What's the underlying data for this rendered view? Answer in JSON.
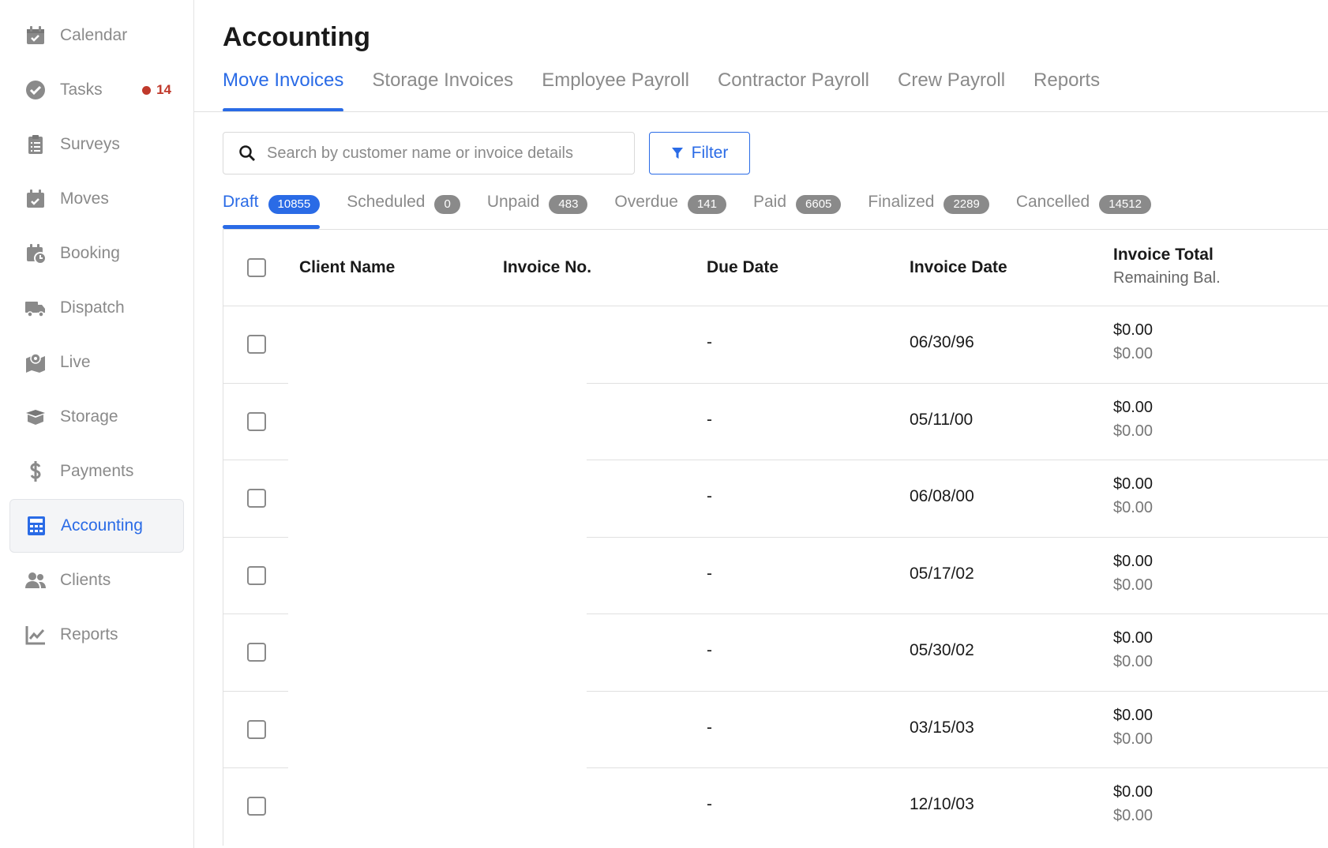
{
  "sidebar": {
    "items": [
      {
        "label": "Calendar",
        "icon": "calendar-icon"
      },
      {
        "label": "Tasks",
        "icon": "check-circle-icon",
        "badge": "14"
      },
      {
        "label": "Surveys",
        "icon": "clipboard-icon"
      },
      {
        "label": "Moves",
        "icon": "calendar-check-icon"
      },
      {
        "label": "Booking",
        "icon": "calendar-clock-icon"
      },
      {
        "label": "Dispatch",
        "icon": "truck-icon"
      },
      {
        "label": "Live",
        "icon": "map-pin-icon"
      },
      {
        "label": "Storage",
        "icon": "box-icon"
      },
      {
        "label": "Payments",
        "icon": "dollar-icon"
      },
      {
        "label": "Accounting",
        "icon": "calculator-icon",
        "active": true
      },
      {
        "label": "Clients",
        "icon": "users-icon"
      },
      {
        "label": "Reports",
        "icon": "chart-line-icon"
      }
    ]
  },
  "page": {
    "title": "Accounting"
  },
  "tabs": [
    "Move Invoices",
    "Storage Invoices",
    "Employee Payroll",
    "Contractor Payroll",
    "Crew Payroll",
    "Reports"
  ],
  "search": {
    "placeholder": "Search by customer name or invoice details",
    "value": ""
  },
  "filter": {
    "label": "Filter"
  },
  "status_tabs": [
    {
      "label": "Draft",
      "count": "10855"
    },
    {
      "label": "Scheduled",
      "count": "0"
    },
    {
      "label": "Unpaid",
      "count": "483"
    },
    {
      "label": "Overdue",
      "count": "141"
    },
    {
      "label": "Paid",
      "count": "6605"
    },
    {
      "label": "Finalized",
      "count": "2289"
    },
    {
      "label": "Cancelled",
      "count": "14512"
    }
  ],
  "table": {
    "headers": {
      "client_name": "Client Name",
      "invoice_no": "Invoice No.",
      "due_date": "Due Date",
      "invoice_date": "Invoice Date",
      "invoice_total": "Invoice Total",
      "remaining_bal": "Remaining Bal."
    },
    "rows": [
      {
        "client_name": "",
        "invoice_no": "",
        "due_date": "-",
        "invoice_date": "06/30/96",
        "total": "$0.00",
        "remaining": "$0.00"
      },
      {
        "client_name": "",
        "invoice_no": "",
        "due_date": "-",
        "invoice_date": "05/11/00",
        "total": "$0.00",
        "remaining": "$0.00"
      },
      {
        "client_name": "",
        "invoice_no": "",
        "due_date": "-",
        "invoice_date": "06/08/00",
        "total": "$0.00",
        "remaining": "$0.00"
      },
      {
        "client_name": "",
        "invoice_no": "",
        "due_date": "-",
        "invoice_date": "05/17/02",
        "total": "$0.00",
        "remaining": "$0.00"
      },
      {
        "client_name": "",
        "invoice_no": "",
        "due_date": "-",
        "invoice_date": "05/30/02",
        "total": "$0.00",
        "remaining": "$0.00"
      },
      {
        "client_name": "",
        "invoice_no": "",
        "due_date": "-",
        "invoice_date": "03/15/03",
        "total": "$0.00",
        "remaining": "$0.00"
      },
      {
        "client_name": "",
        "invoice_no": "",
        "due_date": "-",
        "invoice_date": "12/10/03",
        "total": "$0.00",
        "remaining": "$0.00"
      }
    ]
  },
  "colors": {
    "accent": "#2a6be6",
    "badge": "#c0392b",
    "muted": "#8a8a8a"
  }
}
